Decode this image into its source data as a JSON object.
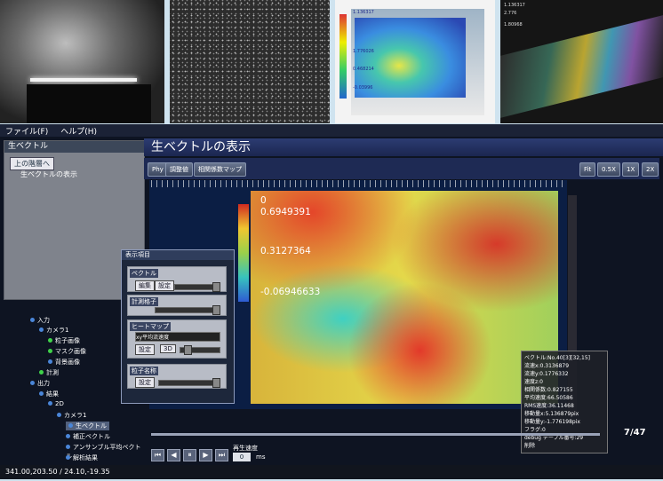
{
  "thumbs": {
    "t3": {
      "top_label": "1.136317",
      "mid_label": "1.776026",
      "low_label": "0.468214",
      "bot_label": "-0.03996"
    },
    "t4": {
      "top_label": "1.136317",
      "mid_label": "2.776",
      "low_label": "1.80968"
    }
  },
  "menu": {
    "file": "ファイル(F)",
    "help": "ヘルプ(H)"
  },
  "left_panel": {
    "header": "生ベクトル",
    "back": "上の階層へ",
    "item": "生ベクトルの表示"
  },
  "tree": [
    {
      "label": "入力"
    },
    {
      "label": "カメラ1"
    },
    {
      "label": "粒子画像"
    },
    {
      "label": "マスク画像"
    },
    {
      "label": "背景画像"
    },
    {
      "label": "計測"
    },
    {
      "label": "出力"
    },
    {
      "label": "結果"
    },
    {
      "label": "2D"
    },
    {
      "label": "カメラ1"
    },
    {
      "label": "生ベクトル"
    },
    {
      "label": "補正ベクトル"
    },
    {
      "label": "アンサンブル平均ベクトル"
    },
    {
      "label": "解析結果"
    }
  ],
  "title": "生ベクトルの表示",
  "toolbar": {
    "phy": "Phy",
    "calib": "調整値",
    "map": "相関係数マップ",
    "fit": "Fit",
    "z05": "0.5X",
    "z1": "1X",
    "z2": "2X"
  },
  "colorbar": {
    "v1": "0",
    "v2": "0.6949391",
    "v3": "0.3127364",
    "v4": "-0.06946633"
  },
  "popup": {
    "title": "表示項目",
    "vector": "ベクトル",
    "vec_edit": "編集",
    "vec_set": "設定",
    "measure": "計測格子",
    "heatmap": "ヒートマップ",
    "select_value": "xy平均流速度",
    "settings": "設定",
    "3d": "3D",
    "particle": "粒子名称",
    "particle_set": "設定"
  },
  "info": {
    "line1": "ベクトル:No.40[3][32,15]",
    "line2": "流速x:0.3136879",
    "line3": "流速y:0.1776332",
    "line4": "速度z:0",
    "line5": "相関係数:0.827155",
    "line6": "平均速度:66.50586",
    "line7": "RMS速度:36.11468",
    "line8": "移動量x:5.136879pix",
    "line9": "移動量y:-1.776198pix",
    "line10": "フラグ:0",
    "line11": "debug テーブル番号:29",
    "line12": "削除"
  },
  "play": {
    "frame": "7/47",
    "speed_label": "再生速度",
    "speed_value": "0",
    "unit": "ms"
  },
  "status": "341.00,203.50 / 24.10,-19.35"
}
